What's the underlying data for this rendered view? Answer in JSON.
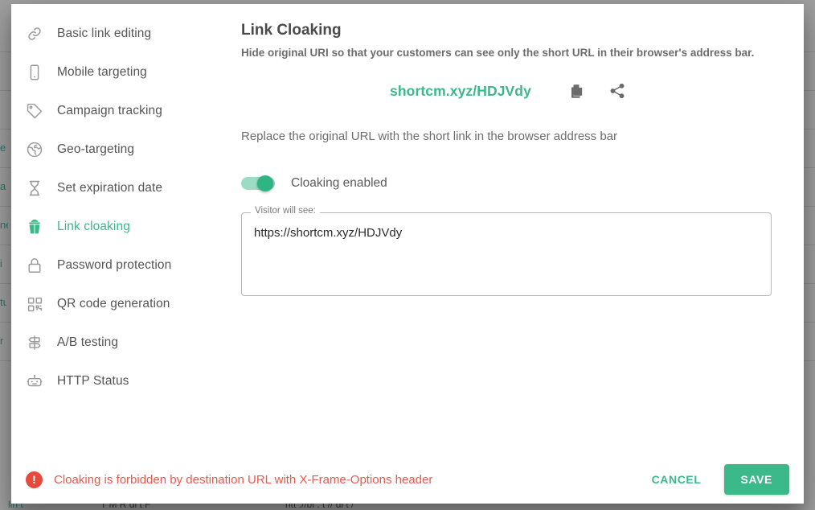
{
  "modal": {
    "sidebar": {
      "items": [
        {
          "label": "Basic link editing",
          "icon": "link-icon",
          "active": false
        },
        {
          "label": "Mobile targeting",
          "icon": "mobile-phone-icon",
          "active": false
        },
        {
          "label": "Campaign tracking",
          "icon": "tag-icon",
          "active": false
        },
        {
          "label": "Geo-targeting",
          "icon": "globe-icon",
          "active": false
        },
        {
          "label": "Set expiration date",
          "icon": "hourglass-icon",
          "active": false
        },
        {
          "label": "Link cloaking",
          "icon": "spy-icon",
          "active": true
        },
        {
          "label": "Password protection",
          "icon": "lock-icon",
          "active": false
        },
        {
          "label": "QR code generation",
          "icon": "qr-code-icon",
          "active": false
        },
        {
          "label": "A/B testing",
          "icon": "signpost-icon",
          "active": false
        },
        {
          "label": "HTTP Status",
          "icon": "robot-icon",
          "active": false
        }
      ]
    },
    "content": {
      "title": "Link Cloaking",
      "subtitle": "Hide original URI so that your customers can see only the short URL in their browser's address bar.",
      "short_url": "shortcm.xyz/HDJVdy",
      "copy_icon": "copy-icon",
      "share_icon": "share-icon",
      "replace_note": "Replace the original URL with the short link in the browser address bar",
      "toggle_label": "Cloaking enabled",
      "toggle_state": "on",
      "visitor_legend": "Visitor will see:",
      "visitor_value": "https://shortcm.xyz/HDJVdy"
    },
    "footer": {
      "error_icon": "error-exclamation-icon",
      "error_text": "Cloaking is forbidden by destination URL with X-Frame-Options header",
      "cancel_label": "CANCEL",
      "save_label": "SAVE"
    }
  },
  "colors": {
    "accent_green": "#3bb98b",
    "toggle_knob": "#2eb583",
    "toggle_track": "#9ddcc4",
    "error_red": "#e8594a",
    "backdrop": "#9e9e9e"
  },
  "background": {
    "fragments": [
      "e",
      "a",
      "ne",
      "i",
      "tu",
      "r"
    ]
  }
}
